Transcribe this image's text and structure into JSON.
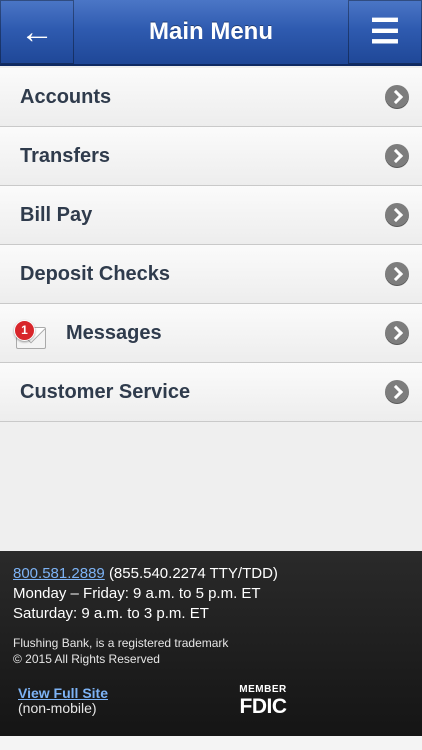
{
  "header": {
    "title": "Main Menu",
    "back_icon": "←",
    "menu_icon": "☰"
  },
  "menu": {
    "items": [
      {
        "label": "Accounts"
      },
      {
        "label": "Transfers"
      },
      {
        "label": "Bill Pay"
      },
      {
        "label": "Deposit Checks"
      },
      {
        "label": "Messages",
        "badge": "1"
      },
      {
        "label": "Customer Service"
      }
    ]
  },
  "footer": {
    "phone": "800.581.2889",
    "tty": "(855.540.2274 TTY/TDD)",
    "hours_weekday": "Monday – Friday: 9 a.m. to 5 p.m. ET",
    "hours_saturday": "Saturday: 9 a.m. to 3 p.m. ET",
    "trademark": "Flushing Bank, is a registered trademark",
    "copyright": "© 2015 All Rights Reserved",
    "full_site_link": "View Full Site",
    "full_site_note": "(non-mobile)",
    "fdic_member": "MEMBER",
    "fdic_name": "FDIC"
  },
  "colors": {
    "header_blue": "#2f5bb0",
    "link_blue": "#7db3f5",
    "badge_red": "#d8262b"
  }
}
